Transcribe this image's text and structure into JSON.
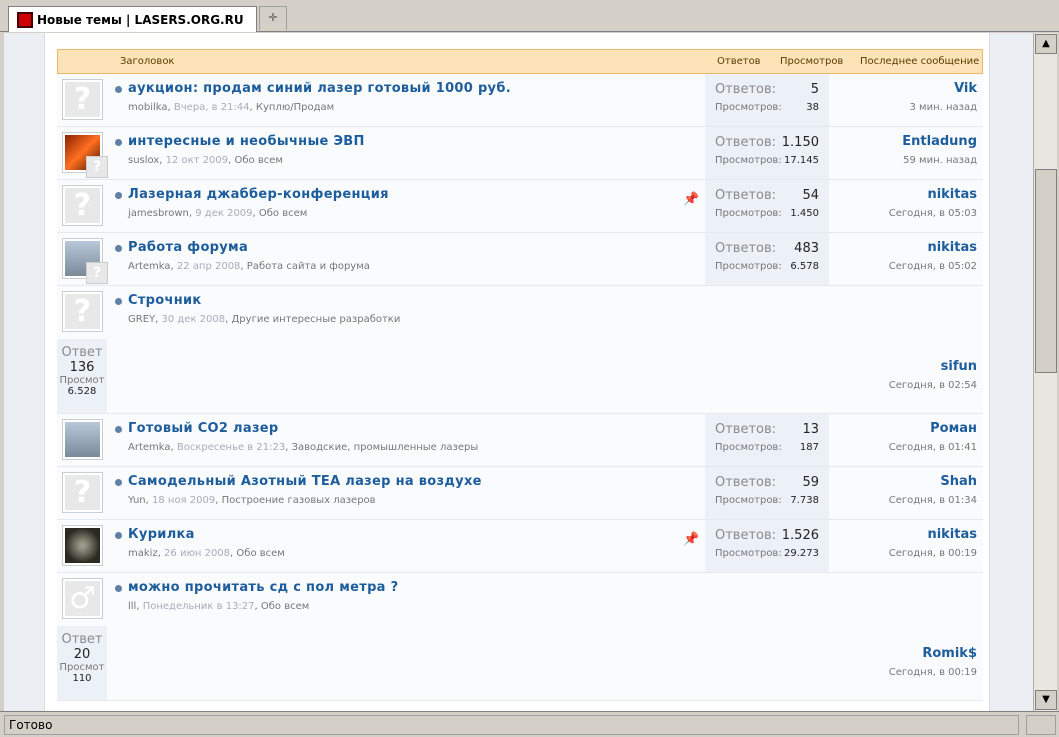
{
  "tab": {
    "title": "Новые темы | LASERS.ORG.RU",
    "newtab_glyph": "✛"
  },
  "header": {
    "col_title": "Заголовок",
    "col_replies": "Ответов",
    "col_views": "Просмотров",
    "col_last": "Последнее сообщение"
  },
  "labels": {
    "replies": "Ответов:",
    "views": "Просмотров:",
    "replies_cut": "Ответ",
    "views_cut": "Просмот",
    "pin_icon": "pushpin-icon"
  },
  "threads": [
    {
      "title": "аукцион: продам синий лазер готовый 1000 руб.",
      "author": "mobilka",
      "date": "Вчера, в 21:44",
      "forum": "Куплю/Продам",
      "replies": "5",
      "views": "38",
      "last_user": "Vik",
      "last_time": "3 мин. назад",
      "avatar": "placeholder-avatar"
    },
    {
      "title": "интересные и необычные ЭВП",
      "author": "suslox",
      "date": "12 окт 2009",
      "forum": "Обо всем",
      "replies": "1.150",
      "views": "17.145",
      "last_user": "Entladung",
      "last_time": "59 мин. назад",
      "avatar": "fire-avatar"
    },
    {
      "title": "Лазерная джаббер-конференция",
      "author": "jamesbrown",
      "date": "9 дек 2009",
      "forum": "Обо всем",
      "replies": "54",
      "views": "1.450",
      "last_user": "nikitas",
      "last_time": "Сегодня, в 05:03",
      "avatar": "placeholder-avatar",
      "pinned": true
    },
    {
      "title": "Работа форума",
      "author": "Artemka",
      "date": "22 апр 2008",
      "forum": "Работа сайта и форума",
      "replies": "483",
      "views": "6.578",
      "last_user": "nikitas",
      "last_time": "Сегодня, в 05:02",
      "avatar": "photo-avatar"
    },
    {
      "title": "Строчник",
      "author": "GREY",
      "date": "30 дек 2008",
      "forum": "Другие интересные разработки",
      "replies": "136",
      "views": "6.528",
      "last_user": "sifun",
      "last_time": "Сегодня, в 02:54",
      "avatar": "placeholder-avatar"
    },
    {
      "title": "Готовый CO2 лазер",
      "author": "Artemka",
      "date": "Воскресенье в 21:23",
      "forum": "Заводские, промышленные лазеры",
      "replies": "13",
      "views": "187",
      "last_user": "Роман",
      "last_time": "Сегодня, в 01:41",
      "avatar": "photo-avatar"
    },
    {
      "title": "Самодельный Азотный TEA лазер на воздухе",
      "author": "Yun",
      "date": "18 ноя 2009",
      "forum": "Построение газовых лазеров",
      "replies": "59",
      "views": "7.738",
      "last_user": "Shah",
      "last_time": "Сегодня, в 01:34",
      "avatar": "placeholder-avatar"
    },
    {
      "title": "Курилка",
      "author": "makiz",
      "date": "26 июн 2008",
      "forum": "Обо всем",
      "replies": "1.526",
      "views": "29.273",
      "last_user": "nikitas",
      "last_time": "Сегодня, в 00:19",
      "avatar": "dark-avatar",
      "pinned": true
    },
    {
      "title": "можно прочитать сд с пол метра ?",
      "author": "lll",
      "date": "Понедельник в 13:27",
      "forum": "Обо всем",
      "replies": "20",
      "views": "110",
      "last_user": "Romik$",
      "last_time": "Сегодня, в 00:19",
      "avatar": "male-avatar"
    }
  ],
  "status": {
    "text": "Готово"
  },
  "scrollbar": {
    "up_glyph": "▲",
    "down_glyph": "▼"
  }
}
